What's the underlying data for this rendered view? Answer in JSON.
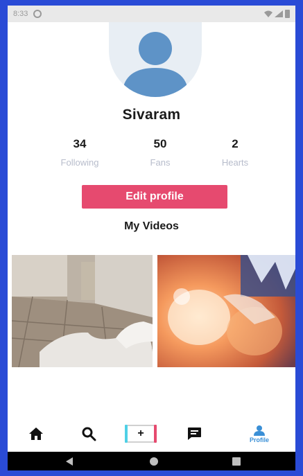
{
  "status_bar": {
    "time": "8:33"
  },
  "profile": {
    "username": "Sivaram",
    "stats": [
      {
        "value": "34",
        "label": "Following"
      },
      {
        "value": "50",
        "label": "Fans"
      },
      {
        "value": "2",
        "label": "Hearts"
      }
    ],
    "edit_button_label": "Edit profile",
    "videos_title": "My Videos"
  },
  "videos": [
    {
      "description": "room-floor-video-thumbnail"
    },
    {
      "description": "orange-light-video-thumbnail"
    }
  ],
  "bottom_nav": {
    "items": [
      {
        "icon": "home-icon"
      },
      {
        "icon": "search-icon"
      },
      {
        "icon": "add-icon",
        "label": "+"
      },
      {
        "icon": "message-icon"
      },
      {
        "icon": "profile-icon",
        "label": "Profile",
        "active": true
      }
    ]
  },
  "colors": {
    "accent": "#e64a6f",
    "active_nav": "#3a8fd6",
    "muted_label": "#b7bccb",
    "frame": "#2a4bd6"
  }
}
